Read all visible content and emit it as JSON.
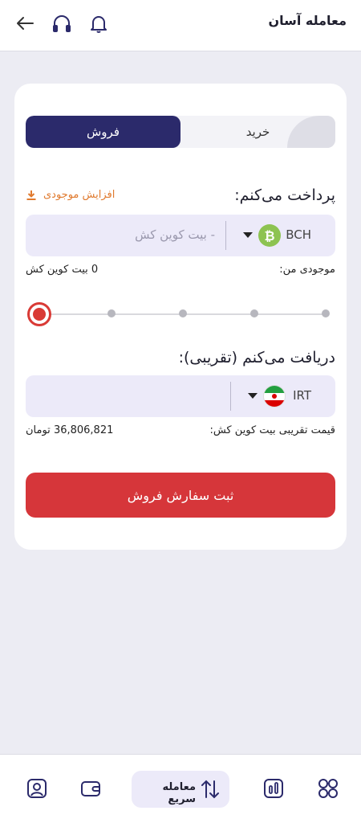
{
  "header": {
    "title": "معامله آسان",
    "icons": [
      "back-arrow-icon",
      "headphones-icon",
      "bell-icon"
    ]
  },
  "trade": {
    "tabs": {
      "sell": "فروش",
      "buy": "خرید",
      "active": "sell"
    },
    "pay": {
      "title": "پرداخت می‌کنم:",
      "increase_balance": "افزایش موجودی",
      "currency_code": "BCH",
      "placeholder": "- بیت کوین کش",
      "balance_label": "موجودی من:",
      "balance_value": "0 بیت کوین کش"
    },
    "slider": {
      "value_fraction": 0,
      "steps": 5
    },
    "receive": {
      "title": "دریافت می‌کنم (تقریبی):",
      "currency_code": "IRT",
      "approx_price_label": "قیمت تقریبی بیت کوین کش:",
      "approx_price_value": "36,806,821 تومان"
    },
    "submit_label": "ثبت سفارش فروش"
  },
  "bottom_nav": {
    "center_label": "معامله سریع",
    "items": [
      "profile-icon",
      "wallet-icon",
      "quick-trade-icon",
      "chart-icon",
      "dashboard-icon"
    ]
  },
  "colors": {
    "accent_navy": "#2b2a6b",
    "danger_red": "#d6363a",
    "bch_green": "#8dc351",
    "increase_orange": "#e07a2e"
  }
}
